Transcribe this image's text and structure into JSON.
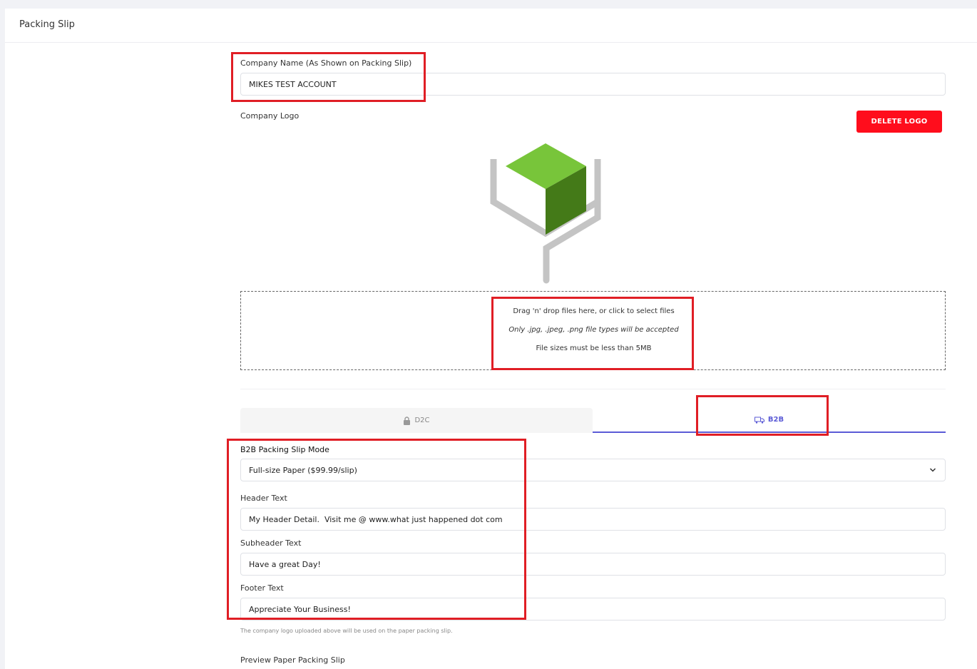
{
  "page": {
    "title": "Packing Slip"
  },
  "company_name": {
    "label": "Company Name (As Shown on Packing Slip)",
    "value": "MIKES TEST ACCOUNT"
  },
  "company_logo": {
    "label": "Company Logo",
    "delete_label": "DELETE LOGO"
  },
  "dropzone": {
    "line1": "Drag 'n' drop files here, or click to select files",
    "line2": "Only .jpg, .jpeg, .png file types will be accepted",
    "line3": "File sizes must be less than 5MB"
  },
  "tabs": [
    {
      "label": "D2C",
      "icon": "lock-icon",
      "active": false
    },
    {
      "label": "B2B",
      "icon": "truck-icon",
      "active": true
    }
  ],
  "b2b": {
    "mode_label": "B2B Packing Slip Mode",
    "mode_value": "Full-size Paper ($99.99/slip)",
    "header_label": "Header Text",
    "header_value": "My Header Detail.  Visit me @ www.what just happened dot com",
    "subheader_label": "Subheader Text",
    "subheader_value": "Have a great Day!",
    "footer_label": "Footer Text",
    "footer_value": "Appreciate Your Business!",
    "note": "The company logo uploaded above will be used on the paper packing slip.",
    "preview_label": "Preview Paper Packing Slip"
  },
  "colors": {
    "accent": "#5b5bd6",
    "danger": "#ff0d1c",
    "highlight": "#e01e25",
    "logo_green_light": "#78c53a",
    "logo_green_dark": "#447a18",
    "logo_gray": "#c4c4c4"
  }
}
